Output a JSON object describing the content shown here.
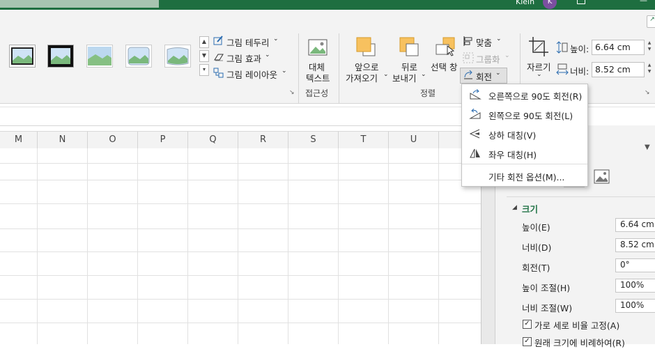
{
  "title_bar": {
    "user_name": "Klein",
    "avatar_initial": "K"
  },
  "ribbon": {
    "picture_styles": {
      "border_label": "그림 테두리",
      "effects_label": "그림 효과",
      "layout_label": "그림 레이아웃"
    },
    "accessibility": {
      "alt_text_line1": "대체",
      "alt_text_line2": "텍스트",
      "group_label": "접근성"
    },
    "arrange": {
      "bring_forward_line1": "앞으로",
      "bring_forward_line2": "가져오기",
      "send_backward_line1": "뒤로",
      "send_backward_line2": "보내기",
      "selection_pane": "선택 창",
      "align": "맞춤",
      "group": "그룹화",
      "rotate": "회전",
      "group_label": "정렬"
    },
    "size": {
      "crop": "자르기",
      "height_label": "높이:",
      "height_value": "6.64 cm",
      "width_label": "너비:",
      "width_value": "8.52 cm"
    }
  },
  "sheet": {
    "columns": [
      "M",
      "N",
      "O",
      "P",
      "Q",
      "R",
      "S",
      "T",
      "U"
    ]
  },
  "rotate_menu": {
    "items": [
      {
        "icon": "rotate-right-90-icon",
        "label": "오른쪽으로 90도 회전(R)"
      },
      {
        "icon": "rotate-left-90-icon",
        "label": "왼쪽으로 90도 회전(L)"
      },
      {
        "icon": "flip-vertical-icon",
        "label": "상하 대칭(V)"
      },
      {
        "icon": "flip-horizontal-icon",
        "label": "좌우 대칭(H)"
      }
    ],
    "more_options": "기타 회전 옵션(M)..."
  },
  "format_pane": {
    "section_title": "크기",
    "height_label": "높이(E)",
    "height_value": "6.64 cm",
    "width_label": "너비(D)",
    "width_value": "8.52 cm",
    "rotation_label": "회전(T)",
    "rotation_value": "0°",
    "scale_height_label": "높이 조절(H)",
    "scale_height_value": "100%",
    "scale_width_label": "너비 조절(W)",
    "scale_width_value": "100%",
    "lock_aspect_label": "가로 세로 비율 고정(A)",
    "relative_original_label": "원래 크기에 비례하여(R)"
  },
  "colors": {
    "title_bar": "#1e6e40",
    "ribbon_bg": "#f3f3f3",
    "accent_green": "#217346",
    "avatar": "#7b4fa0",
    "section_green": "#217346"
  }
}
